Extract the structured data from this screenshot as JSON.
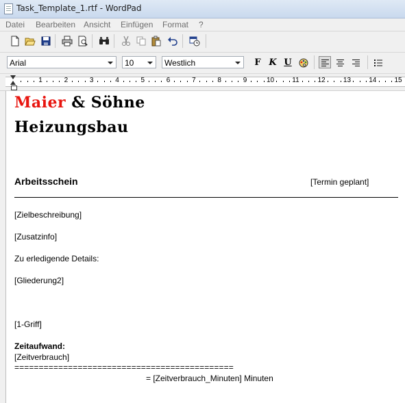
{
  "window": {
    "title": "Task_Template_1.rtf - WordPad"
  },
  "menu": [
    "Datei",
    "Bearbeiten",
    "Ansicht",
    "Einfügen",
    "Format",
    "?"
  ],
  "toolbar": {
    "icons": [
      "new-document-icon",
      "open-folder-icon",
      "save-icon",
      "print-icon",
      "print-preview-icon",
      "find-icon",
      "cut-icon",
      "copy-icon",
      "paste-icon",
      "undo-icon",
      "insert-datetime-icon"
    ]
  },
  "format": {
    "font": "Arial",
    "size": "10",
    "script": "Westlich",
    "bold_label": "F",
    "italic_label": "K",
    "underline_label": "U",
    "active_alignment": "left"
  },
  "ruler": {
    "numbers": [
      "1",
      "2",
      "3",
      "4",
      "5",
      "6",
      "7",
      "8",
      "9",
      "10",
      "11",
      "12",
      "13",
      "14",
      "15"
    ]
  },
  "document": {
    "company_name_red": "Maier",
    "company_name_rest": " & Söhne",
    "company_line2": "Heizungsbau",
    "heading": "Arbeitsschein",
    "termin": "[Termin geplant]",
    "zielbeschreibung": "[Zielbeschreibung]",
    "zusatzinfo": "[Zusatzinfo]",
    "details_label": "Zu erledigende Details:",
    "gliederung": "[Gliederung2]",
    "griff": "[1-Griff]",
    "zeitaufwand_label": "Zeitaufwand:",
    "zeitverbrauch": "[Zeitverbrauch]",
    "separator": "=============================================",
    "minuten_line": "= [Zeitverbrauch_Minuten] Minuten",
    "company_red_color": "#e8150f"
  }
}
